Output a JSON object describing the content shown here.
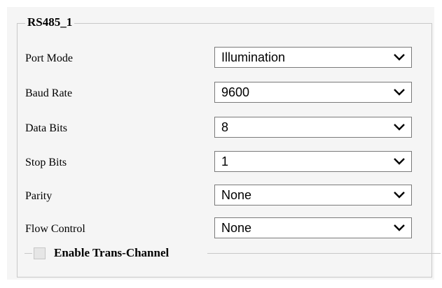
{
  "group": {
    "title": "RS485_1"
  },
  "fields": [
    {
      "label": "Port Mode",
      "value": "Illumination"
    },
    {
      "label": "Baud Rate",
      "value": "9600"
    },
    {
      "label": "Data Bits",
      "value": "8"
    },
    {
      "label": "Stop Bits",
      "value": "1"
    },
    {
      "label": "Parity",
      "value": "None"
    },
    {
      "label": "Flow Control",
      "value": "None"
    }
  ],
  "trans_channel": {
    "label": "Enable Trans-Channel",
    "checked": false
  },
  "icons": {
    "dropdown": "chevron-down-icon"
  }
}
